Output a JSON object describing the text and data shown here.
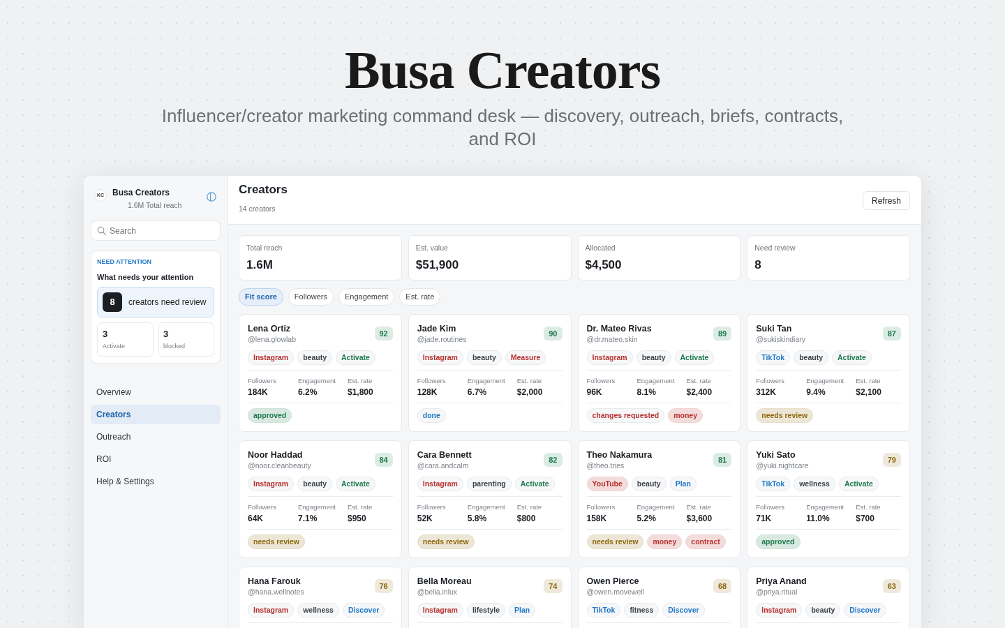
{
  "hero": {
    "title": "Busa Creators",
    "subtitle": "Influencer/creator marketing command desk — discovery, outreach, briefs, contracts, and ROI"
  },
  "sidebar": {
    "logo": "KC",
    "brand": "Busa Creators",
    "brand_sub": "1.6M Total reach",
    "search": {
      "placeholder": "Search"
    },
    "attention": {
      "eyebrow": "NEED ATTENTION",
      "title": "What needs your attention",
      "alert": {
        "count": "8",
        "label": "creators need review"
      },
      "tiles": [
        {
          "value": "3",
          "label": "Activate"
        },
        {
          "value": "3",
          "label": "blocked"
        }
      ]
    },
    "nav": [
      {
        "label": "Overview",
        "selected": false
      },
      {
        "label": "Creators",
        "selected": true
      },
      {
        "label": "Outreach",
        "selected": false
      },
      {
        "label": "ROI",
        "selected": false
      },
      {
        "label": "Help & Settings",
        "selected": false
      }
    ]
  },
  "header": {
    "title": "Creators",
    "subtitle": "14 creators",
    "button": "Refresh"
  },
  "stats": [
    {
      "label": "Total reach",
      "value": "1.6M"
    },
    {
      "label": "Est. value",
      "value": "$51,900"
    },
    {
      "label": "Allocated",
      "value": "$4,500"
    },
    {
      "label": "Need review",
      "value": "8"
    }
  ],
  "sort_chips": [
    {
      "label": "Fit score",
      "selected": true
    },
    {
      "label": "Followers",
      "selected": false
    },
    {
      "label": "Engagement",
      "selected": false
    },
    {
      "label": "Est. rate",
      "selected": false
    }
  ],
  "creators": [
    {
      "name": "Lena Ortiz",
      "handle": "@lena.glowlab",
      "score": {
        "text": "92",
        "color": "#1e7b4f"
      },
      "tags": [
        {
          "text": "Instagram",
          "color": "#b8322f",
          "filled": false
        },
        {
          "text": "beauty",
          "color": "#3d4248",
          "filled": false
        },
        {
          "text": "Activate",
          "color": "#1e7b4f",
          "filled": false
        }
      ],
      "metrics": [
        {
          "label": "Followers",
          "value": "184K"
        },
        {
          "label": "Engagement",
          "value": "6.2%"
        },
        {
          "label": "Est. rate",
          "value": "$1,800"
        }
      ],
      "statuses": [
        {
          "text": "approved",
          "color": "#1e7b4f",
          "filled": true
        }
      ]
    },
    {
      "name": "Jade Kim",
      "handle": "@jade.routines",
      "score": {
        "text": "90",
        "color": "#1e7b4f"
      },
      "tags": [
        {
          "text": "Instagram",
          "color": "#b8322f",
          "filled": false
        },
        {
          "text": "beauty",
          "color": "#3d4248",
          "filled": false
        },
        {
          "text": "Measure",
          "color": "#b8322f",
          "filled": false
        }
      ],
      "metrics": [
        {
          "label": "Followers",
          "value": "128K"
        },
        {
          "label": "Engagement",
          "value": "6.7%"
        },
        {
          "label": "Est. rate",
          "value": "$2,000"
        }
      ],
      "statuses": [
        {
          "text": "done",
          "color": "#1f78c8",
          "filled": false
        }
      ]
    },
    {
      "name": "Dr. Mateo Rivas",
      "handle": "@dr.mateo.skin",
      "score": {
        "text": "89",
        "color": "#1e7b4f"
      },
      "tags": [
        {
          "text": "Instagram",
          "color": "#b8322f",
          "filled": false
        },
        {
          "text": "beauty",
          "color": "#3d4248",
          "filled": false
        },
        {
          "text": "Activate",
          "color": "#1e7b4f",
          "filled": false
        }
      ],
      "metrics": [
        {
          "label": "Followers",
          "value": "96K"
        },
        {
          "label": "Engagement",
          "value": "8.1%"
        },
        {
          "label": "Est. rate",
          "value": "$2,400"
        }
      ],
      "statuses": [
        {
          "text": "changes requested",
          "color": "#b8322f",
          "filled": false
        },
        {
          "text": "money",
          "color": "#b8322f",
          "filled": true
        }
      ]
    },
    {
      "name": "Suki Tan",
      "handle": "@sukiskindiary",
      "score": {
        "text": "87",
        "color": "#1e7b4f"
      },
      "tags": [
        {
          "text": "TikTok",
          "color": "#1f78c8",
          "filled": false
        },
        {
          "text": "beauty",
          "color": "#3d4248",
          "filled": false
        },
        {
          "text": "Activate",
          "color": "#1e7b4f",
          "filled": false
        }
      ],
      "metrics": [
        {
          "label": "Followers",
          "value": "312K"
        },
        {
          "label": "Engagement",
          "value": "9.4%"
        },
        {
          "label": "Est. rate",
          "value": "$2,100"
        }
      ],
      "statuses": [
        {
          "text": "needs review",
          "color": "#8f6a10",
          "filled": true
        }
      ]
    },
    {
      "name": "Noor Haddad",
      "handle": "@noor.cleanbeauty",
      "score": {
        "text": "84",
        "color": "#1e7b4f"
      },
      "tags": [
        {
          "text": "Instagram",
          "color": "#b8322f",
          "filled": false
        },
        {
          "text": "beauty",
          "color": "#3d4248",
          "filled": false
        },
        {
          "text": "Activate",
          "color": "#1e7b4f",
          "filled": false
        }
      ],
      "metrics": [
        {
          "label": "Followers",
          "value": "64K"
        },
        {
          "label": "Engagement",
          "value": "7.1%"
        },
        {
          "label": "Est. rate",
          "value": "$950"
        }
      ],
      "statuses": [
        {
          "text": "needs review",
          "color": "#8f6a10",
          "filled": true
        }
      ]
    },
    {
      "name": "Cara Bennett",
      "handle": "@cara.andcalm",
      "score": {
        "text": "82",
        "color": "#1e7b4f"
      },
      "tags": [
        {
          "text": "Instagram",
          "color": "#b8322f",
          "filled": false
        },
        {
          "text": "parenting",
          "color": "#3d4248",
          "filled": false
        },
        {
          "text": "Activate",
          "color": "#1e7b4f",
          "filled": false
        }
      ],
      "metrics": [
        {
          "label": "Followers",
          "value": "52K"
        },
        {
          "label": "Engagement",
          "value": "5.8%"
        },
        {
          "label": "Est. rate",
          "value": "$800"
        }
      ],
      "statuses": [
        {
          "text": "needs review",
          "color": "#8f6a10",
          "filled": true
        }
      ]
    },
    {
      "name": "Theo Nakamura",
      "handle": "@theo.tries",
      "score": {
        "text": "81",
        "color": "#1e7b4f"
      },
      "tags": [
        {
          "text": "YouTube",
          "color": "#b8322f",
          "filled": true
        },
        {
          "text": "beauty",
          "color": "#3d4248",
          "filled": false
        },
        {
          "text": "Plan",
          "color": "#1f78c8",
          "filled": false
        }
      ],
      "metrics": [
        {
          "label": "Followers",
          "value": "158K"
        },
        {
          "label": "Engagement",
          "value": "5.2%"
        },
        {
          "label": "Est. rate",
          "value": "$3,600"
        }
      ],
      "statuses": [
        {
          "text": "needs review",
          "color": "#8f6a10",
          "filled": true
        },
        {
          "text": "money",
          "color": "#b8322f",
          "filled": true
        },
        {
          "text": "contract",
          "color": "#b8322f",
          "filled": true
        }
      ]
    },
    {
      "name": "Yuki Sato",
      "handle": "@yuki.nightcare",
      "score": {
        "text": "79",
        "color": "#8f6a10"
      },
      "tags": [
        {
          "text": "TikTok",
          "color": "#1f78c8",
          "filled": false
        },
        {
          "text": "wellness",
          "color": "#3d4248",
          "filled": false
        },
        {
          "text": "Activate",
          "color": "#1e7b4f",
          "filled": false
        }
      ],
      "metrics": [
        {
          "label": "Followers",
          "value": "71K"
        },
        {
          "label": "Engagement",
          "value": "11.0%"
        },
        {
          "label": "Est. rate",
          "value": "$700"
        }
      ],
      "statuses": [
        {
          "text": "approved",
          "color": "#1e7b4f",
          "filled": true
        }
      ]
    },
    {
      "name": "Hana Farouk",
      "handle": "@hana.wellnotes",
      "score": {
        "text": "76",
        "color": "#8f6a10"
      },
      "tags": [
        {
          "text": "Instagram",
          "color": "#b8322f",
          "filled": false
        },
        {
          "text": "wellness",
          "color": "#3d4248",
          "filled": false
        },
        {
          "text": "Discover",
          "color": "#1f78c8",
          "filled": false
        }
      ]
    },
    {
      "name": "Bella Moreau",
      "handle": "@bella.inlux",
      "score": {
        "text": "74",
        "color": "#8f6a10"
      },
      "tags": [
        {
          "text": "Instagram",
          "color": "#b8322f",
          "filled": false
        },
        {
          "text": "lifestyle",
          "color": "#3d4248",
          "filled": false
        },
        {
          "text": "Plan",
          "color": "#1f78c8",
          "filled": false
        }
      ]
    },
    {
      "name": "Owen Pierce",
      "handle": "@owen.movewell",
      "score": {
        "text": "68",
        "color": "#8f6a10"
      },
      "tags": [
        {
          "text": "TikTok",
          "color": "#1f78c8",
          "filled": false
        },
        {
          "text": "fitness",
          "color": "#3d4248",
          "filled": false
        },
        {
          "text": "Discover",
          "color": "#1f78c8",
          "filled": false
        }
      ]
    },
    {
      "name": "Priya Anand",
      "handle": "@priya.ritual",
      "score": {
        "text": "63",
        "color": "#8f6a10"
      },
      "tags": [
        {
          "text": "Instagram",
          "color": "#b8322f",
          "filled": false
        },
        {
          "text": "beauty",
          "color": "#3d4248",
          "filled": false
        },
        {
          "text": "Discover",
          "color": "#1f78c8",
          "filled": false
        }
      ]
    }
  ]
}
